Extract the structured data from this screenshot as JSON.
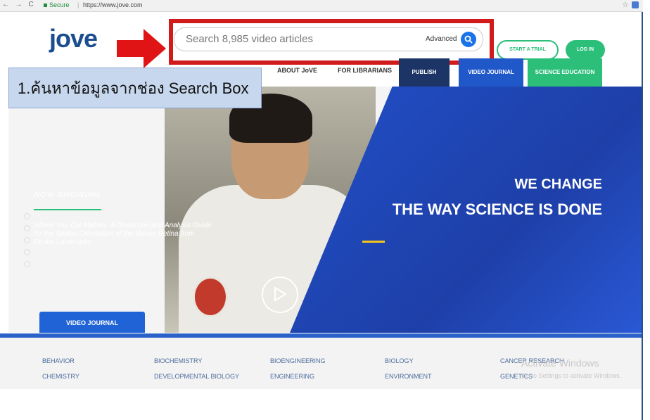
{
  "browser": {
    "nav_glyphs": "← → C",
    "secure_label": "Secure",
    "url": "https://www.jove.com",
    "star": "☆"
  },
  "header": {
    "logo": "jove",
    "search_placeholder": "Search 8,985 video articles",
    "advanced_label": "Advanced",
    "start_trial_label": "START A TRIAL",
    "login_label": "LOG IN"
  },
  "nav": {
    "links": [
      "ABOUT JoVE",
      "FOR LIBRARIANS"
    ],
    "tiles": [
      "PUBLISH",
      "VIDEO JOURNAL",
      "SCIENCE EDUCATION"
    ]
  },
  "instruction": "1.ค้นหาข้อมูลจากช่อง Search Box",
  "hero": {
    "now_showing": "NOW SHOWING",
    "article_title": "Where You Cut Matters: A Dissection and Analysis Guide for the Spatial Orientation of the Mouse Retina from Ocular Landmarks",
    "tagline_line1": "WE CHANGE",
    "tagline_line2": "THE WAY SCIENCE IS DONE",
    "tab_label": "VIDEO JOURNAL"
  },
  "categories": {
    "row1": [
      "BEHAVIOR",
      "BIOCHEMISTRY",
      "BIOENGINEERING",
      "BIOLOGY",
      "CANCER RESEARCH"
    ],
    "row2": [
      "CHEMISTRY",
      "DEVELOPMENTAL BIOLOGY",
      "ENGINEERING",
      "ENVIRONMENT",
      "GENETICS"
    ]
  },
  "watermark": {
    "title": "Activate Windows",
    "subtitle": "Go to Settings to activate Windows."
  },
  "colors": {
    "brand_blue": "#1b4d8f",
    "accent_green": "#2bbf7a",
    "highlight_red": "#d11a1a",
    "publish_tile": "#1d3566",
    "video_tile": "#2158c9",
    "education_tile": "#2bbf7a"
  }
}
